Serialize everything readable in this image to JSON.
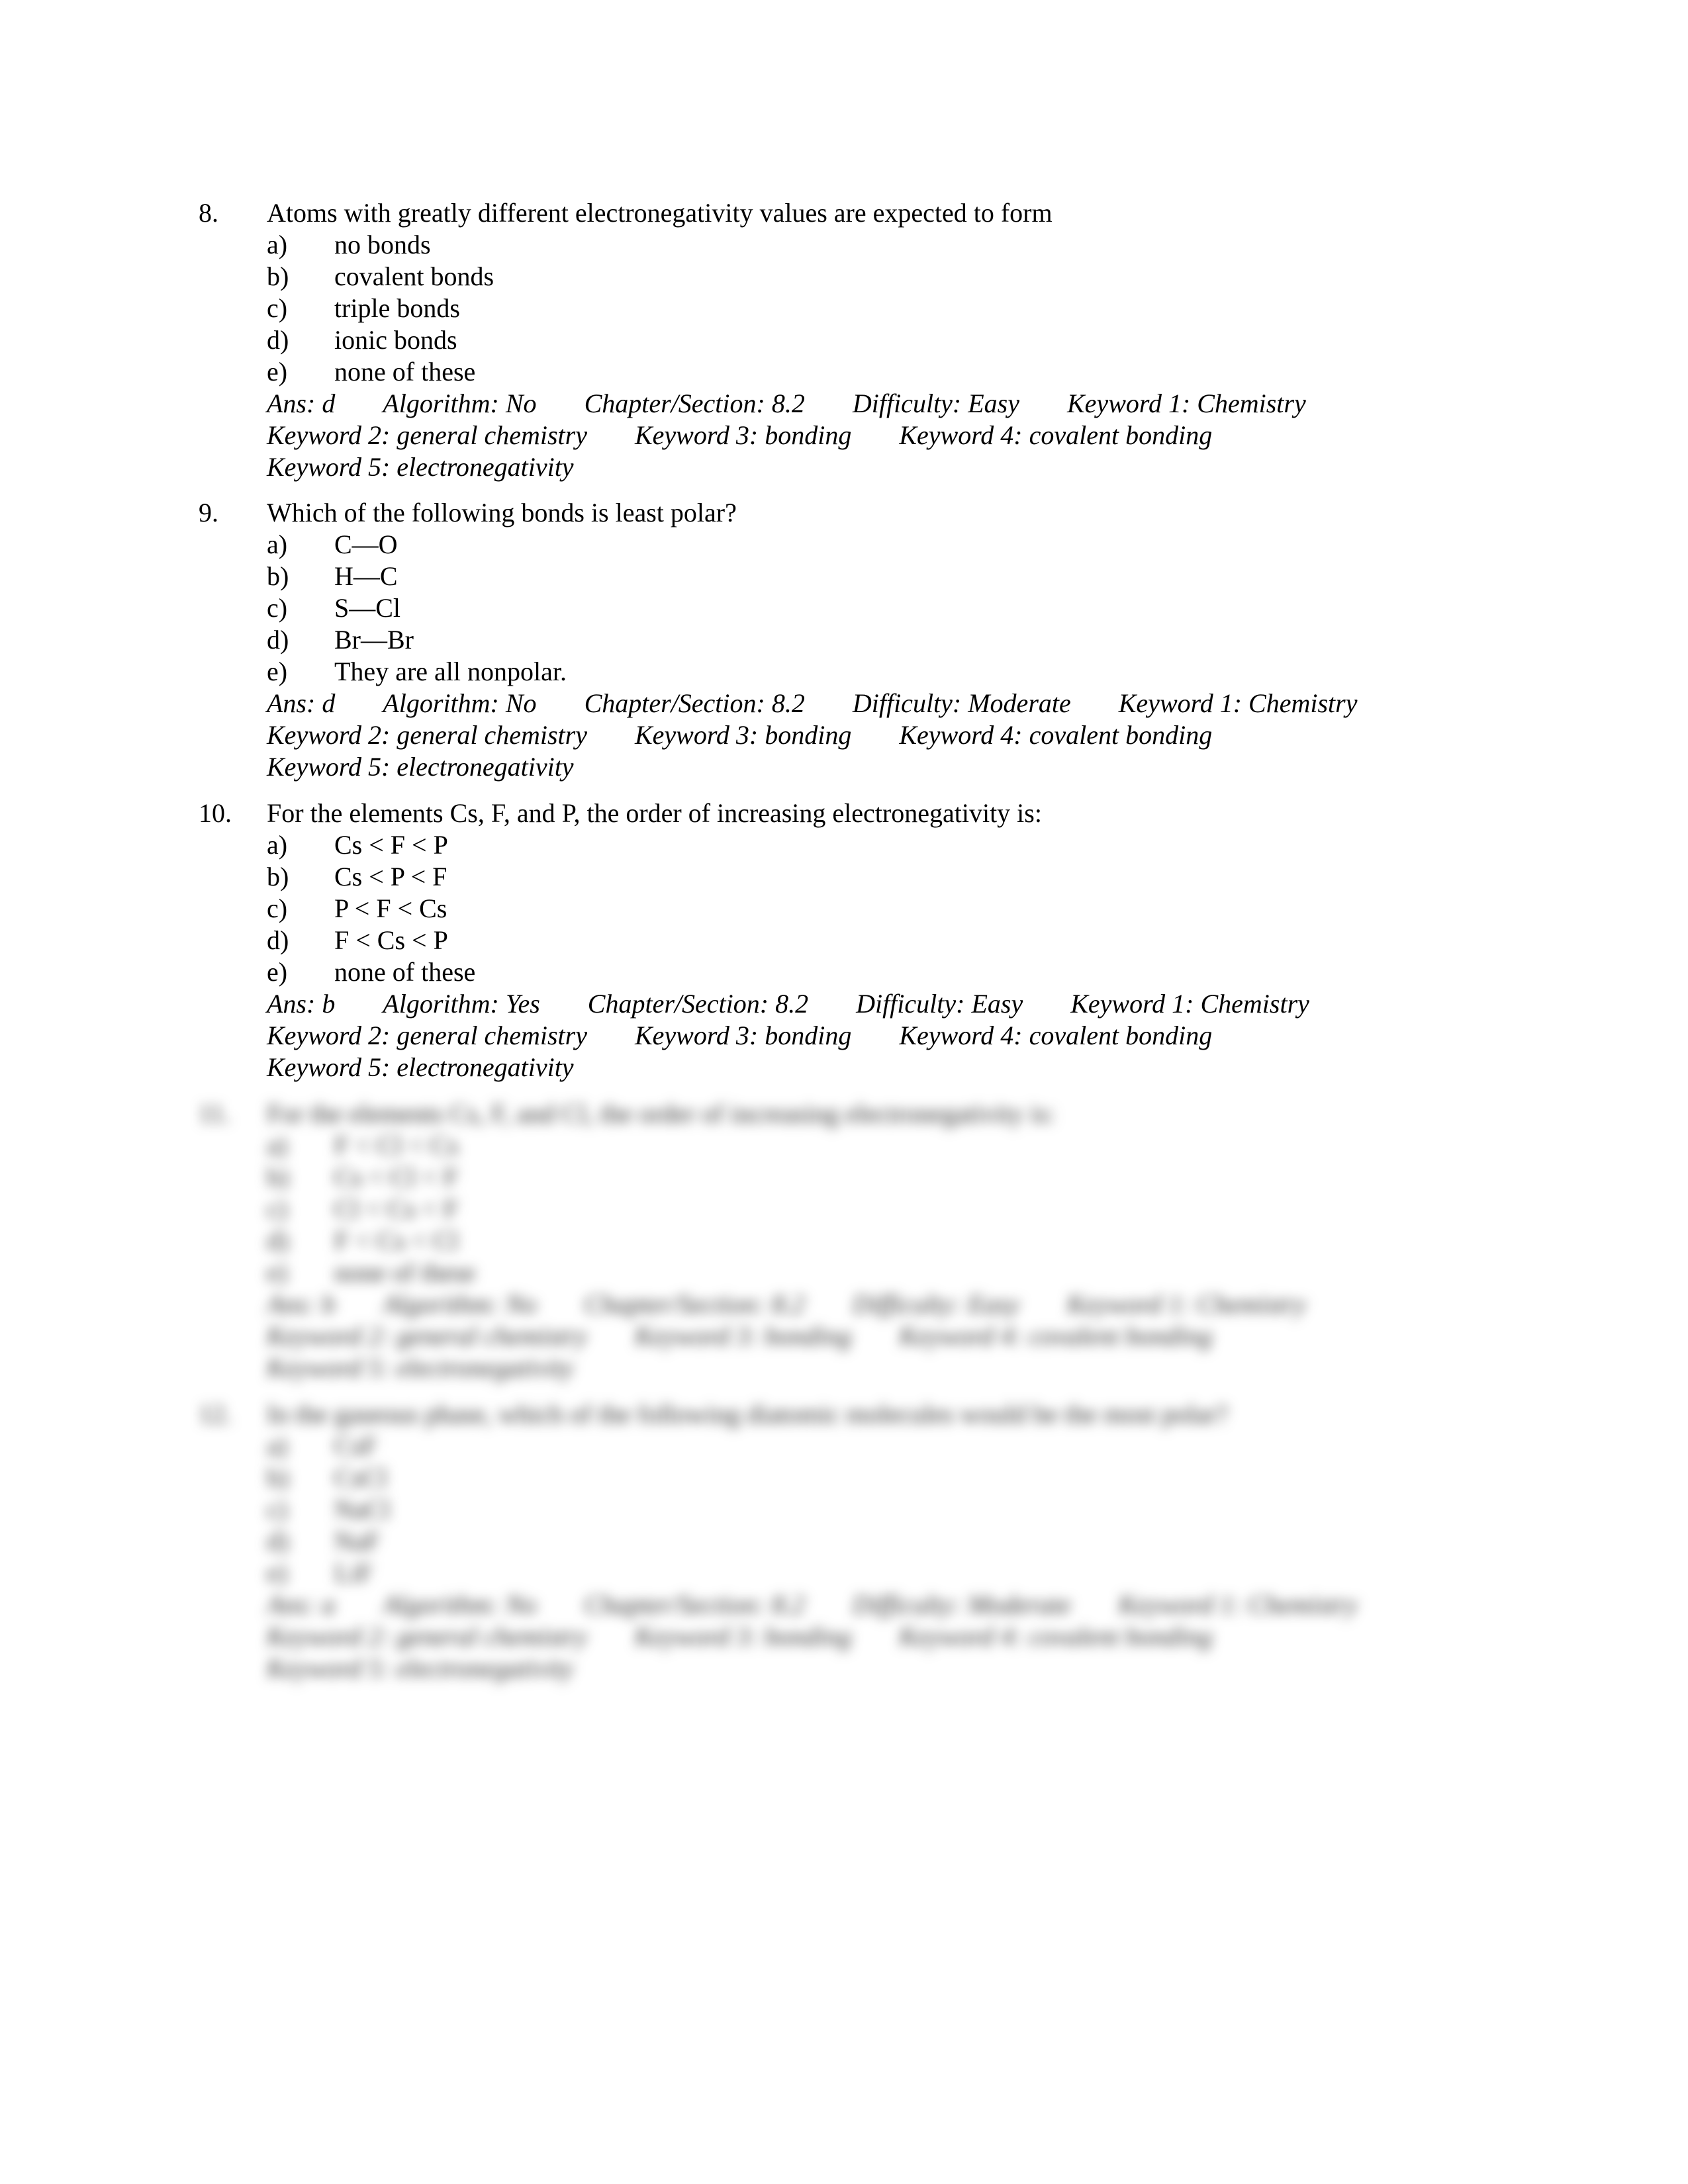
{
  "questions": [
    {
      "number": "8.",
      "text": "Atoms with greatly different electronegativity values are expected to form",
      "options": [
        {
          "letter": "a)",
          "text": "no bonds"
        },
        {
          "letter": "b)",
          "text": "covalent bonds"
        },
        {
          "letter": "c)",
          "text": "triple bonds"
        },
        {
          "letter": "d)",
          "text": "ionic bonds"
        },
        {
          "letter": "e)",
          "text": "none of these"
        }
      ],
      "meta": [
        [
          "Ans:  d",
          "Algorithm:  No",
          "Chapter/Section:  8.2",
          "Difficulty:  Easy",
          "Keyword 1:  Chemistry"
        ],
        [
          "Keyword 2:  general chemistry",
          "Keyword 3:  bonding",
          "Keyword 4:  covalent bonding"
        ],
        [
          "Keyword 5:  electronegativity"
        ]
      ]
    },
    {
      "number": "9.",
      "text": "Which of the following bonds is least polar?",
      "options": [
        {
          "letter": "a)",
          "text": "C—O"
        },
        {
          "letter": "b)",
          "text": "H—C"
        },
        {
          "letter": "c)",
          "text": "S—Cl"
        },
        {
          "letter": "d)",
          "text": "Br—Br"
        },
        {
          "letter": "e)",
          "text": "They are all nonpolar."
        }
      ],
      "meta": [
        [
          "Ans:  d",
          "Algorithm:  No",
          "Chapter/Section:  8.2",
          "Difficulty:  Moderate",
          "Keyword 1:  Chemistry"
        ],
        [
          "Keyword 2:  general chemistry",
          "Keyword 3:  bonding",
          "Keyword 4:  covalent bonding"
        ],
        [
          "Keyword 5:  electronegativity"
        ]
      ]
    },
    {
      "number": "10.",
      "text": "For the elements Cs, F, and P, the order of increasing electronegativity is:",
      "options": [
        {
          "letter": "a)",
          "text": "Cs < F < P"
        },
        {
          "letter": "b)",
          "text": "Cs < P < F"
        },
        {
          "letter": "c)",
          "text": "P < F < Cs"
        },
        {
          "letter": "d)",
          "text": "F < Cs < P"
        },
        {
          "letter": "e)",
          "text": "none of these"
        }
      ],
      "meta": [
        [
          "Ans:  b",
          "Algorithm:  Yes",
          "Chapter/Section:  8.2",
          "Difficulty:  Easy",
          "Keyword 1:  Chemistry"
        ],
        [
          "Keyword 2:  general chemistry",
          "Keyword 3:  bonding",
          "Keyword 4:  covalent bonding"
        ],
        [
          "Keyword 5:  electronegativity"
        ]
      ]
    },
    {
      "number": "11.",
      "text": "For the elements Cs, F, and Cl, the order of increasing electronegativity is:",
      "options": [
        {
          "letter": "a)",
          "text": "F < Cl < Cs"
        },
        {
          "letter": "b)",
          "text": "Cs < Cl < F"
        },
        {
          "letter": "c)",
          "text": "Cl < Cs < F"
        },
        {
          "letter": "d)",
          "text": "F < Cs < Cl"
        },
        {
          "letter": "e)",
          "text": "none of these"
        }
      ],
      "meta": [
        [
          "Ans:  b",
          "Algorithm:  No",
          "Chapter/Section:  8.2",
          "Difficulty:  Easy",
          "Keyword 1:  Chemistry"
        ],
        [
          "Keyword 2:  general chemistry",
          "Keyword 3:  bonding",
          "Keyword 4:  covalent bonding"
        ],
        [
          "Keyword 5:  electronegativity"
        ]
      ]
    },
    {
      "number": "12.",
      "text": "In the gaseous phase, which of the following diatomic molecules would be the most polar?",
      "options": [
        {
          "letter": "a)",
          "text": "CsF"
        },
        {
          "letter": "b)",
          "text": "CsCl"
        },
        {
          "letter": "c)",
          "text": "NaCl"
        },
        {
          "letter": "d)",
          "text": "NaF"
        },
        {
          "letter": "e)",
          "text": "LiF"
        }
      ],
      "meta": [
        [
          "Ans:  a",
          "Algorithm:  No",
          "Chapter/Section:  8.2",
          "Difficulty:  Moderate",
          "Keyword 1:  Chemistry"
        ],
        [
          "Keyword 2:  general chemistry",
          "Keyword 3:  bonding",
          "Keyword 4:  covalent bonding"
        ],
        [
          "Keyword 5:  electronegativity"
        ]
      ]
    }
  ]
}
